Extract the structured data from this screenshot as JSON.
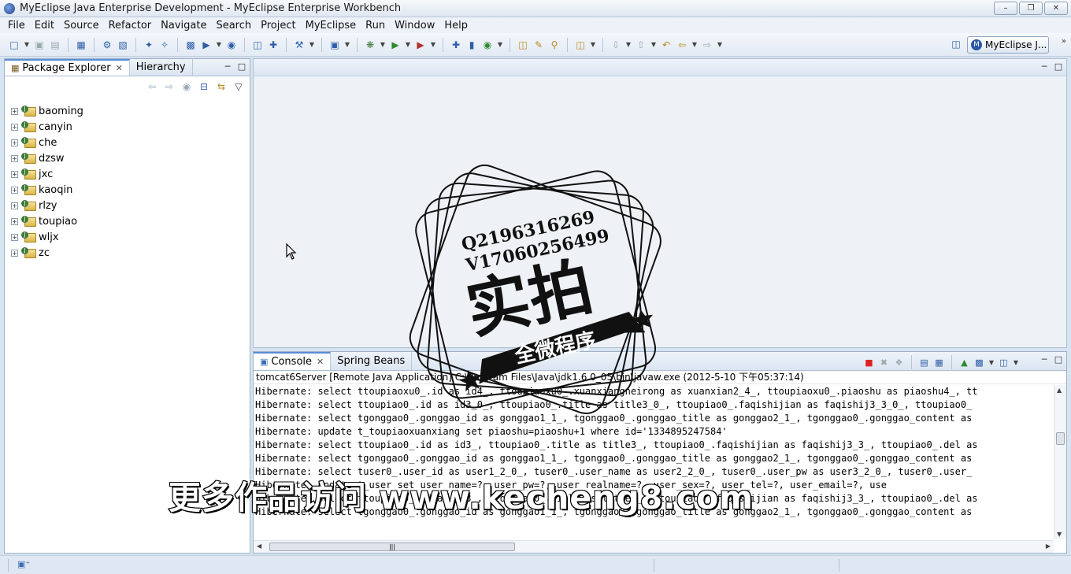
{
  "window": {
    "title": "MyEclipse Java Enterprise Development - MyEclipse Enterprise Workbench",
    "minimize": "–",
    "restore": "❐",
    "close": "✕"
  },
  "menu": [
    "File",
    "Edit",
    "Source",
    "Refactor",
    "Navigate",
    "Search",
    "Project",
    "MyEclipse",
    "Run",
    "Window",
    "Help"
  ],
  "perspective": {
    "label": "MyEclipse J...",
    "icon": "myeclipse-icon"
  },
  "explorer": {
    "tabs": [
      {
        "label": "Package Explorer",
        "active": true
      },
      {
        "label": "Hierarchy",
        "active": false
      }
    ],
    "projects": [
      "baoming",
      "canyin",
      "che",
      "dzsw",
      "jxc",
      "kaoqin",
      "rlzy",
      "toupiao",
      "wljx",
      "zc"
    ]
  },
  "console": {
    "tabs": [
      {
        "label": "Console",
        "active": true
      },
      {
        "label": "Spring Beans",
        "active": false
      }
    ],
    "launch": "tomcat6Server [Remote Java Application] C:\\Program Files\\Java\\jdk1.6.0_05\\bin\\javaw.exe (2012-5-10 下午05:37:14)",
    "lines": [
      "Hibernate: select ttoupiaoxu0_.id as id4_, ttoupiaoxu0_.xuanxiangneirong as xuanxian2_4_, ttoupiaoxu0_.piaoshu as piaoshu4_, tt",
      "Hibernate: select ttoupiao0_.id as id3_0_, ttoupiao0_.title as title3_0_, ttoupiao0_.faqishijian as faqishij3_3_0_, ttoupiao0_",
      "Hibernate: select tgonggao0_.gonggao_id as gonggao1_1_, tgonggao0_.gonggao_title as gonggao2_1_, tgonggao0_.gonggao_content as",
      "Hibernate: update t_toupiaoxuanxiang set piaoshu=piaoshu+1 where id='1334895247584'",
      "Hibernate: select ttoupiao0_.id as id3_, ttoupiao0_.title as title3_, ttoupiao0_.faqishijian as faqishij3_3_, ttoupiao0_.del as",
      "Hibernate: select tgonggao0_.gonggao_id as gonggao1_1_, tgonggao0_.gonggao_title as gonggao2_1_, tgonggao0_.gonggao_content as",
      "Hibernate: select tuser0_.user_id as user1_2_0_, tuser0_.user_name as user2_2_0_, tuser0_.user_pw as user3_2_0_, tuser0_.user_",
      "Hibernate: update t_user set user_name=?, user_pw=?, user_realname=?, user_sex=?, user_tel=?, user_email=?, use",
      "Hibernate: select ttoupiao0_.id as id3_, ttoupiao0_.title as title3_, ttoupiao0_.faqishijian as faqishij3_3_, ttoupiao0_.del as",
      "Hibernate: select tgonggao0_.gonggao_id as gonggao1_1_, tgonggao0_.gonggao_title as gonggao2_1_, tgonggao0_.gonggao_content as"
    ]
  },
  "stamp": {
    "line1": "Q2196316269",
    "line2": "V17060256499",
    "main": "实拍",
    "banner": "全微程序"
  },
  "watermark": "更多作品访问 www.kecheng8.com"
}
